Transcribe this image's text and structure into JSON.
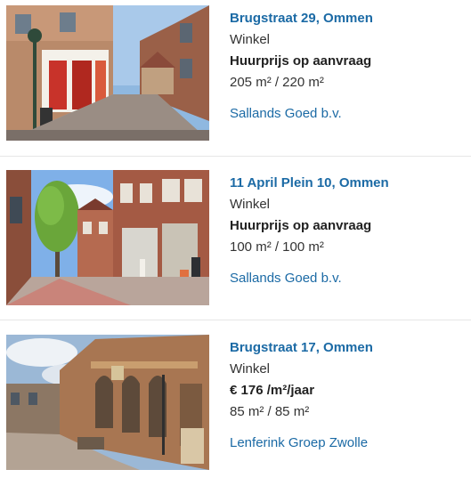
{
  "listings": [
    {
      "address": "Brugstraat 29, Ommen",
      "type": "Winkel",
      "price": "Huurprijs op aanvraag",
      "area": "205 m² / 220 m²",
      "broker": "Sallands Goed b.v."
    },
    {
      "address": "11 April Plein 10, Ommen",
      "type": "Winkel",
      "price": "Huurprijs op aanvraag",
      "area": "100 m² / 100 m²",
      "broker": "Sallands Goed b.v."
    },
    {
      "address": "Brugstraat 17, Ommen",
      "type": "Winkel",
      "price": "€ 176 /m²/jaar",
      "area": "85 m² / 85 m²",
      "broker": "Lenferink Groep Zwolle"
    }
  ],
  "colors": {
    "link": "#1b6aa5",
    "separator": "#e6e6e6",
    "text": "#333333"
  }
}
